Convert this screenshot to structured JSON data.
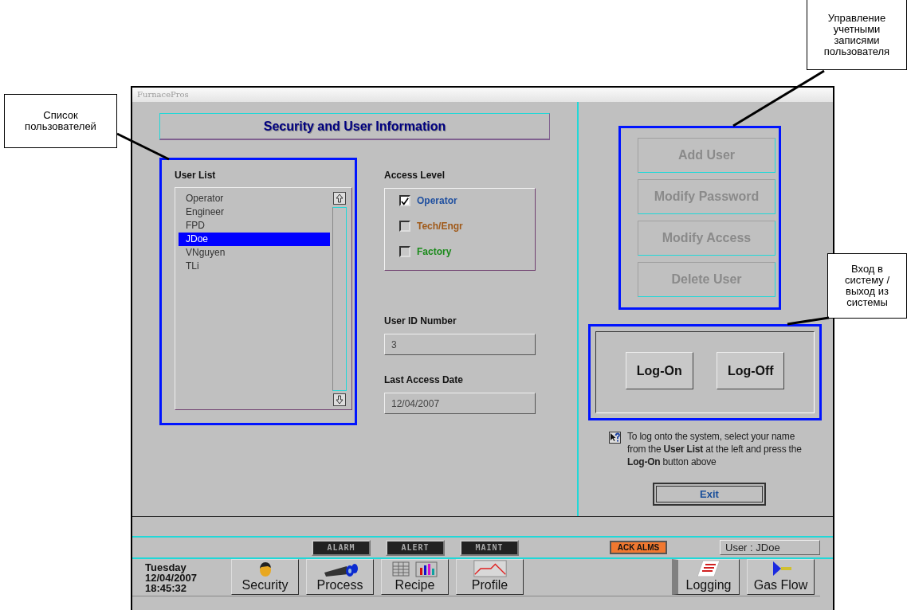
{
  "window": {
    "title": "FurnacePros"
  },
  "header": {
    "title": "Security and User Information"
  },
  "user_list": {
    "label": "User List",
    "items": [
      {
        "name": "Operator",
        "selected": false
      },
      {
        "name": "Engineer",
        "selected": false
      },
      {
        "name": "FPD",
        "selected": false
      },
      {
        "name": "JDoe",
        "selected": true
      },
      {
        "name": "VNguyen",
        "selected": false
      },
      {
        "name": "TLi",
        "selected": false
      }
    ]
  },
  "access_level": {
    "label": "Access Level",
    "options": [
      {
        "label": "Operator",
        "checked": true,
        "color": "#1f4f9f"
      },
      {
        "label": "Tech/Engr",
        "checked": false,
        "color": "#a05a1a"
      },
      {
        "label": "Factory",
        "checked": false,
        "color": "#1a8a1a"
      }
    ]
  },
  "user_id": {
    "label": "User ID Number",
    "value": "3"
  },
  "last_access": {
    "label": "Last Access Date",
    "value": "12/04/2007"
  },
  "account_buttons": [
    {
      "label": "Add User",
      "disabled": true
    },
    {
      "label": "Modify Password",
      "disabled": true
    },
    {
      "label": "Modify Access",
      "disabled": true
    },
    {
      "label": "Delete User",
      "disabled": true
    }
  ],
  "session_buttons": [
    "Log-On",
    "Log-Off"
  ],
  "help_text": "To log onto the system, select your name from the **User List** at the left and press the **Log-On** button above",
  "exit_button": "Exit",
  "alarm_indicators": [
    {
      "label": "ALARM"
    },
    {
      "label": "ALERT"
    },
    {
      "label": "MAINT"
    }
  ],
  "ack_button": "ACK ALMS",
  "user_status": "User : JDoe",
  "datetime": {
    "day": "Tuesday",
    "date": "12/04/2007",
    "time": "18:45:32"
  },
  "nav_buttons": [
    {
      "label": "Security",
      "kind": "security"
    },
    {
      "label": "Process",
      "kind": "process"
    },
    {
      "label": "Recipe",
      "kind": "recipe"
    },
    {
      "label": "Profile",
      "kind": "profile"
    },
    {
      "label": "Logging",
      "kind": "logging"
    },
    {
      "label": "Gas Flow",
      "kind": "gasflow"
    }
  ],
  "callouts": [
    {
      "text": "Список пользователей"
    },
    {
      "text": "Управление учетными записями пользователя"
    },
    {
      "text": "Вход в систему / выход из системы"
    }
  ]
}
